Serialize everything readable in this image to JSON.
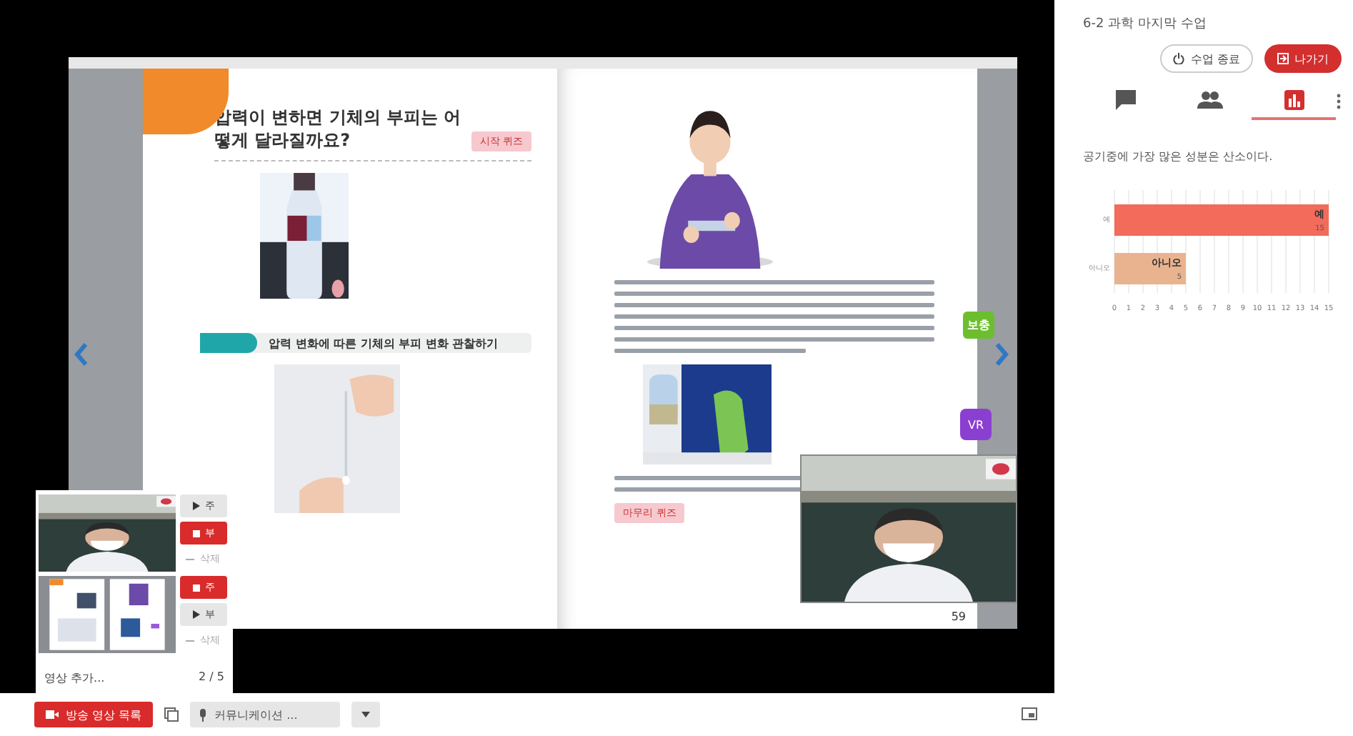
{
  "book": {
    "left_page": {
      "title": "압력이 변하면 기체의 부피는 어떻게 달라질까요?",
      "quiz_tag": "시작 퀴즈",
      "activity": "압력 변화에 따른 기체의 부피 변화 관찰하기"
    },
    "right_page": {
      "side_tab": "보충",
      "vr_badge": "VR",
      "quiz_tag": "마무리 퀴즈",
      "page_number": "59"
    }
  },
  "video_list": {
    "items": [
      {
        "buttons": [
          {
            "kind": "play",
            "label": "주"
          },
          {
            "kind": "stop",
            "label": "부"
          }
        ],
        "delete": "삭제"
      },
      {
        "buttons": [
          {
            "kind": "stop",
            "label": "주"
          },
          {
            "kind": "play",
            "label": "부"
          }
        ],
        "delete": "삭제"
      }
    ],
    "add": "영상 추가...",
    "count": "2 / 5"
  },
  "bottom_bar": {
    "broadcast_button": "방송 영상 목록",
    "source_select": "커뮤니케이션 ..."
  },
  "lesson": {
    "title": "6-2 과학 마지막 수업",
    "end_button": "수업 종료",
    "exit_button": "나가기"
  },
  "panel_tabs": [
    {
      "kind": "chat",
      "selected": false
    },
    {
      "kind": "people",
      "selected": false
    },
    {
      "kind": "poll",
      "selected": true
    }
  ],
  "poll": {
    "question": "공기중에 가장 많은 성분은 산소이다.",
    "chart_data": {
      "type": "bar",
      "orientation": "horizontal",
      "stacked": true,
      "categories": [
        "예",
        "아니오"
      ],
      "series": [
        {
          "name": "예",
          "color": "#f26b5b",
          "values": [
            15,
            null
          ]
        },
        {
          "name": "아니오",
          "color": "#eab38f",
          "values": [
            null,
            5
          ]
        }
      ],
      "xlim": [
        0,
        15
      ],
      "xticks": [
        0,
        1,
        2,
        3,
        4,
        5,
        6,
        7,
        8,
        9,
        10,
        11,
        12,
        13,
        14,
        15
      ],
      "data_labels": true,
      "grid": true
    }
  }
}
